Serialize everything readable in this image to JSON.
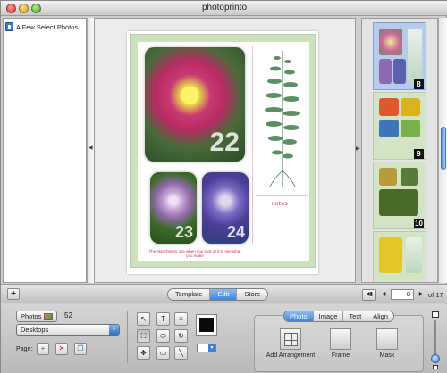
{
  "window": {
    "title": "photoprinto"
  },
  "sidebar": {
    "items": [
      {
        "label": "A Few Select Photos",
        "icon": "photo-album-icon"
      }
    ]
  },
  "canvas": {
    "photo_numbers": [
      "22",
      "23",
      "24"
    ],
    "notes_label": "notes",
    "caption": "The sketches to use when you look at it to see what you make"
  },
  "thumbnails": {
    "pages": [
      "8",
      "9",
      "10"
    ],
    "selected": "8"
  },
  "toolbar": {
    "add_label": "+",
    "modes": [
      "Template",
      "Edit",
      "Store"
    ],
    "active_mode": "Edit",
    "page_current": "8",
    "page_of": "of 17"
  },
  "bottom": {
    "photos_button": "Photos",
    "photo_count": "52",
    "source_select": "Desktops",
    "page_label": "Page:",
    "inspector_tabs": [
      "Photo",
      "Image",
      "Text",
      "Align"
    ],
    "inspector_active_tab": "Photo",
    "add_arrangement": "Add Arrangement",
    "frame": "Frame",
    "mask": "Mask"
  },
  "colors": {
    "accent": "#3f86d8",
    "page_border": "#cfe0bf",
    "notes_text": "#d2275d",
    "fill_color": "#0b0b0b"
  }
}
